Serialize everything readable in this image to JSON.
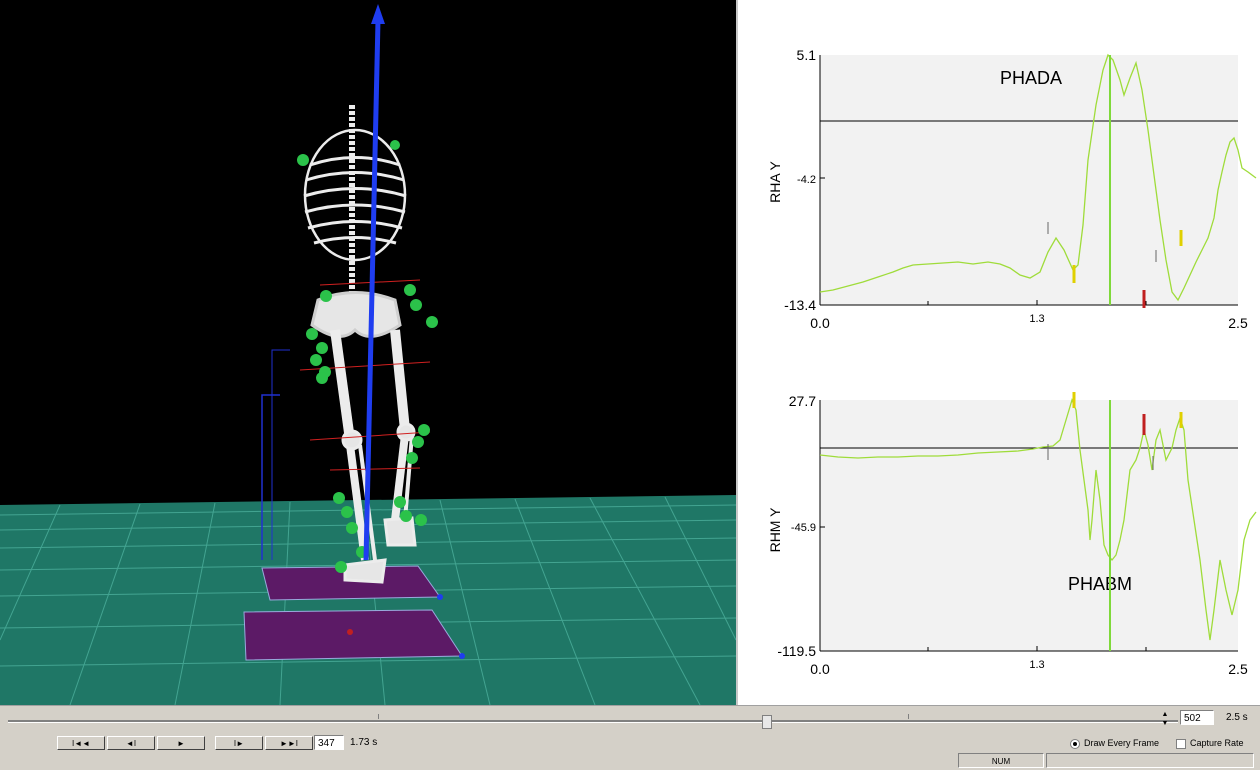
{
  "plots": [
    {
      "ylabel": "RHA Y",
      "annotation": "PHADA",
      "yticks": [
        "5.1",
        "-4.2",
        "-13.4"
      ],
      "xticks": [
        "0.0",
        "1.3",
        "2.5"
      ]
    },
    {
      "ylabel": "RHM Y",
      "annotation": "PHABM",
      "yticks": [
        "27.7",
        "-45.9",
        "-119.5"
      ],
      "xticks": [
        "0.0",
        "1.3",
        "2.5"
      ]
    }
  ],
  "transport": {
    "first_label": "I◄◄",
    "prev_label": "◄I",
    "play_label": "►",
    "next_label": "I►",
    "last_label": "►►I",
    "frame_value": "347",
    "time_value": "1.73 s"
  },
  "timeline": {
    "end_frame": "502",
    "end_time": "2.5 s",
    "position_fraction": 0.65
  },
  "options": {
    "draw_every_frame": "Draw Every Frame",
    "capture_rate": "Capture Rate",
    "draw_every_frame_selected": true
  },
  "status": {
    "num": "NUM"
  },
  "colors": {
    "ground": "#1f7766",
    "plot_bg": "#f2f2f2",
    "trace": "#9fdc3a",
    "cursor": "#7fd93a",
    "vector": "#1f3df0",
    "marker": "#2bc24a",
    "plate": "#5c1a66"
  }
}
